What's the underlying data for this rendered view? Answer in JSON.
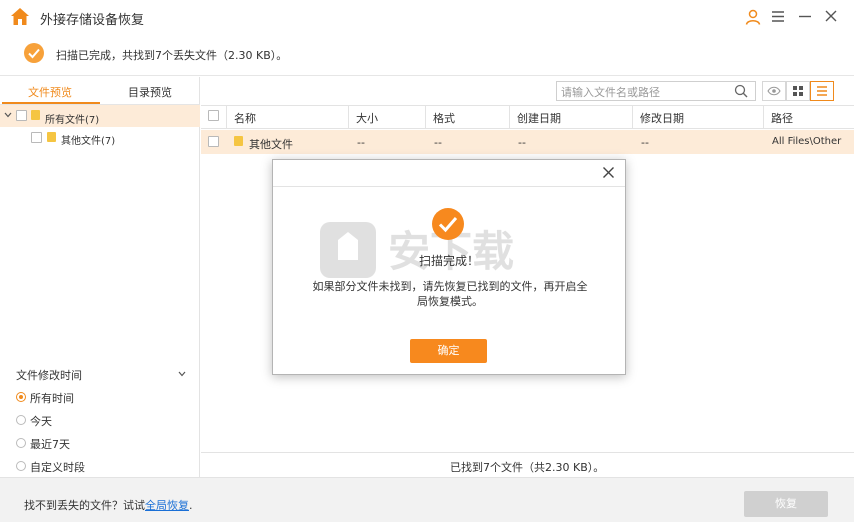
{
  "app": {
    "title": "外接存储设备恢复"
  },
  "status": {
    "text": "扫描已完成，共找到7个丢失文件（2.30 KB）。"
  },
  "left_panel": {
    "tabs": [
      {
        "label": "文件预览"
      },
      {
        "label": "目录预览"
      }
    ],
    "tree": [
      {
        "label": "所有文件(7)"
      },
      {
        "label": "其他文件(7)"
      }
    ],
    "filter": {
      "title": "文件修改时间",
      "options": [
        {
          "label": "所有时间",
          "selected": true
        },
        {
          "label": "今天",
          "selected": false
        },
        {
          "label": "最近7天",
          "selected": false
        },
        {
          "label": "自定义时段",
          "selected": false
        }
      ]
    }
  },
  "search": {
    "placeholder": "请输入文件名或路径"
  },
  "table": {
    "columns": [
      "名称",
      "大小",
      "格式",
      "创建日期",
      "修改日期",
      "路径"
    ],
    "rows": [
      {
        "name": "其他文件",
        "size": "--",
        "format": "--",
        "created": "--",
        "modified": "--",
        "path": "All Files\\Other"
      }
    ]
  },
  "footer": {
    "found_text": "已找到7个文件（共2.30 KB）。"
  },
  "bottom": {
    "prompt": "找不到丢失的文件？试试",
    "link": "全局恢复",
    "suffix": ".",
    "recover_label": "恢复"
  },
  "dialog": {
    "title": "扫描完成！",
    "message": "如果部分文件未找到，请先恢复已找到的文件，再开启全局恢复模式。",
    "ok_label": "确定"
  },
  "watermark": {
    "text": "安下载"
  },
  "colors": {
    "accent": "#f08a1c",
    "selected_row": "#fdebd8",
    "link": "#1a6fd6"
  }
}
